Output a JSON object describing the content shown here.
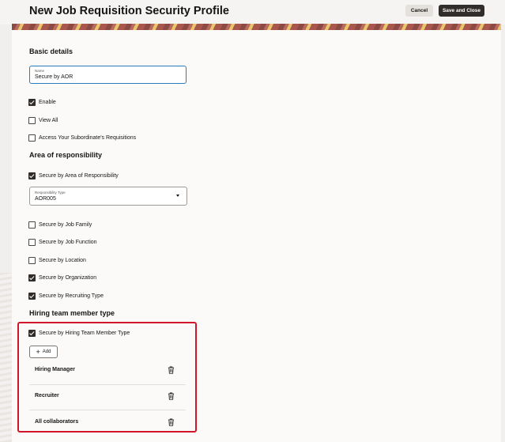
{
  "header": {
    "title": "New Job Requisition Security Profile",
    "cancel_label": "Cancel",
    "save_close_label": "Save and Close"
  },
  "basic_details": {
    "title": "Basic details",
    "name_field": {
      "label": "Name",
      "value": "Secure by AOR"
    },
    "checkboxes": [
      {
        "label": "Enable",
        "checked": true
      },
      {
        "label": "View All",
        "checked": false
      },
      {
        "label": "Access Your Subordinate's Requisitions",
        "checked": false
      }
    ]
  },
  "area_of_responsibility": {
    "title": "Area of responsibility",
    "secure_by_aor": {
      "label": "Secure by Area of Responsibility",
      "checked": true
    },
    "responsibility_type": {
      "label": "Responsibility Type",
      "value": "AOR005"
    },
    "checkboxes": [
      {
        "label": "Secure by Job Family",
        "checked": false
      },
      {
        "label": "Secure by Job Function",
        "checked": false
      },
      {
        "label": "Secure by Location",
        "checked": false
      },
      {
        "label": "Secure by Organization",
        "checked": true
      },
      {
        "label": "Secure by Recruiting Type",
        "checked": true
      }
    ]
  },
  "hiring_team": {
    "title": "Hiring team member type",
    "secure_checkbox": {
      "label": "Secure by Hiring Team Member Type",
      "checked": true
    },
    "add_label": "Add",
    "members": [
      {
        "name": "Hiring Manager",
        "icon": "trash-icon"
      },
      {
        "name": "Recruiter",
        "icon": "trash-icon"
      },
      {
        "name": "All collaborators",
        "icon": "trash-icon"
      }
    ]
  },
  "colors": {
    "accent": "#2b7bb9",
    "primary_button": "#312d2a",
    "highlight": "#d1152b"
  }
}
